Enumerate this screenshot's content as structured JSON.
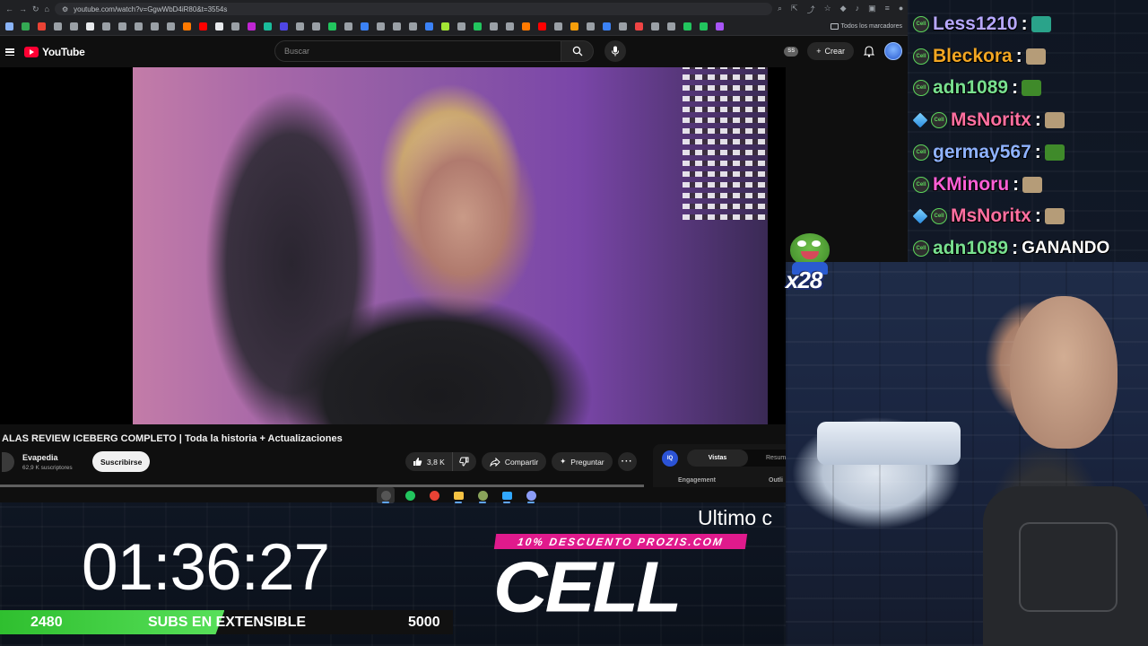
{
  "browser": {
    "url": "youtube.com/watch?v=GgwWbD4iR80&t=3554s",
    "bookmarks_folder": "Todos los marcadores",
    "bookmark_colors": [
      "#8ab4f8",
      "#34a853",
      "#ea4335",
      "#9aa0a6",
      "#9aa0a6",
      "#e8eaed",
      "#9aa0a6",
      "#9aa0a6",
      "#9aa0a6",
      "#9aa0a6",
      "#9aa0a6",
      "#ff7a00",
      "#ff0000",
      "#e8eaed",
      "#9aa0a6",
      "#c026d3",
      "#1abc9c",
      "#4f46e5",
      "#9aa0a6",
      "#9aa0a6",
      "#22c55e",
      "#9aa0a6",
      "#3b82f6",
      "#9aa0a6",
      "#9aa0a6",
      "#9aa0a6",
      "#3b82f6",
      "#a3e635",
      "#9aa0a6",
      "#22c55e",
      "#9aa0a6",
      "#9aa0a6",
      "#ff7a00",
      "#ff0000",
      "#9aa0a6",
      "#f59e0b",
      "#9aa0a6",
      "#3b82f6",
      "#9aa0a6",
      "#ef4444",
      "#9aa0a6",
      "#9aa0a6",
      "#22c55e",
      "#22c55e",
      "#a855f7"
    ]
  },
  "youtube": {
    "logo_text": "YouTube",
    "search_placeholder": "Buscar",
    "ss_badge": "SS",
    "create_label": "Crear",
    "video": {
      "title": "ALAS REVIEW ICEBERG COMPLETO | Toda la historia + Actualizaciones",
      "channel": "Evapedia",
      "subscribers": "62,9 K suscriptores",
      "subscribe_label": "Suscribirse",
      "likes": "3,8 K",
      "share_label": "Compartir",
      "ask_label": "Preguntar",
      "more_label": "···"
    },
    "side_panel": {
      "icon_text": "IQ",
      "tab_active": "Vistas",
      "tab_other": "Resum",
      "label_1": "Engagement",
      "label_2": "Outli"
    }
  },
  "taskbar": {
    "apps": [
      {
        "name": "obs-icon",
        "color": "#555555",
        "active": true
      },
      {
        "name": "game-icon",
        "color": "#22c55e",
        "active": false
      },
      {
        "name": "chrome-icon",
        "color": "#ea4335",
        "active": false
      },
      {
        "name": "folder-icon",
        "color": "#f6c343",
        "active": false
      },
      {
        "name": "tool-icon",
        "color": "#8aa35a",
        "active": false
      },
      {
        "name": "photoshop-icon",
        "color": "#31a8ff",
        "active": false
      },
      {
        "name": "discord-icon",
        "color": "#8b9cf7",
        "active": false
      }
    ]
  },
  "overlay": {
    "timer": "01:36:27",
    "subs_start": "2480",
    "subs_label": "SUBS EN EXTENSIBLE",
    "subs_goal": "5000",
    "subs_progress": 0.496,
    "ultimo_text": "Ultimo c",
    "promo_text": "10% DESCUENTO PROZIS.COM",
    "promo_code": "CELL",
    "alert_count": "x28"
  },
  "chat": {
    "messages": [
      {
        "user": "Less1210",
        "color": "#b7a8ff",
        "badges": [
          "tier"
        ],
        "emote": "#2aa38a",
        "text": ""
      },
      {
        "user": "Bleckora",
        "color": "#f2a623",
        "badges": [
          "tier"
        ],
        "emote": "#b59c78",
        "text": ""
      },
      {
        "user": "adn1089",
        "color": "#78e08f",
        "badges": [
          "tier"
        ],
        "emote": "#3f8a2a",
        "text": ""
      },
      {
        "user": "MsNoritx",
        "color": "#ff6fa0",
        "badges": [
          "cube",
          "tier"
        ],
        "emote": "#b59c78",
        "text": ""
      },
      {
        "user": "germay567",
        "color": "#8fb3ff",
        "badges": [
          "tier"
        ],
        "emote": "#3f8a2a",
        "text": ""
      },
      {
        "user": "KMinoru",
        "color": "#ff5fd6",
        "badges": [
          "tier"
        ],
        "emote": "#b59c78",
        "text": ""
      },
      {
        "user": "MsNoritx",
        "color": "#ff6fa0",
        "badges": [
          "cube",
          "tier"
        ],
        "emote": "#b59c78",
        "text": ""
      },
      {
        "user": "adn1089",
        "color": "#78e08f",
        "badges": [
          "tier"
        ],
        "emote": "",
        "text": "GANANDO"
      }
    ]
  }
}
